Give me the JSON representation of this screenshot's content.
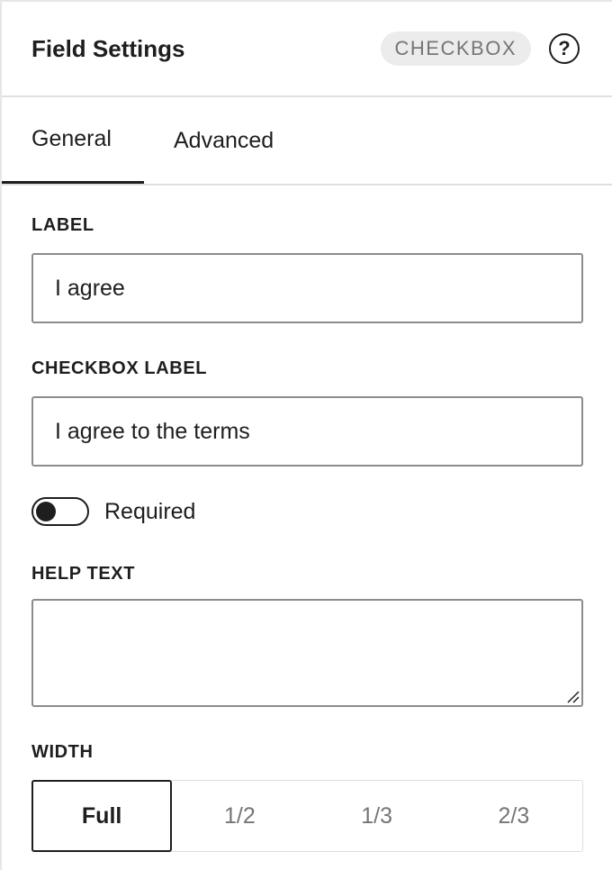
{
  "header": {
    "title": "Field Settings",
    "type_badge": "CHECKBOX",
    "help_icon": "?"
  },
  "tabs": [
    {
      "label": "General",
      "active": true
    },
    {
      "label": "Advanced",
      "active": false
    }
  ],
  "label_field": {
    "label": "LABEL",
    "value": "I agree"
  },
  "checkbox_label_field": {
    "label": "CHECKBOX LABEL",
    "value": "I agree to the terms"
  },
  "required_toggle": {
    "label": "Required",
    "checked": false
  },
  "help_text_field": {
    "label": "HELP TEXT",
    "value": ""
  },
  "width": {
    "label": "WIDTH",
    "options": [
      "Full",
      "1/2",
      "1/3",
      "2/3"
    ],
    "selected": "Full"
  },
  "colors": {
    "text": "#1e1e1e",
    "muted": "#757575",
    "badge_bg": "#ececec",
    "border": "#8c8c8c"
  }
}
